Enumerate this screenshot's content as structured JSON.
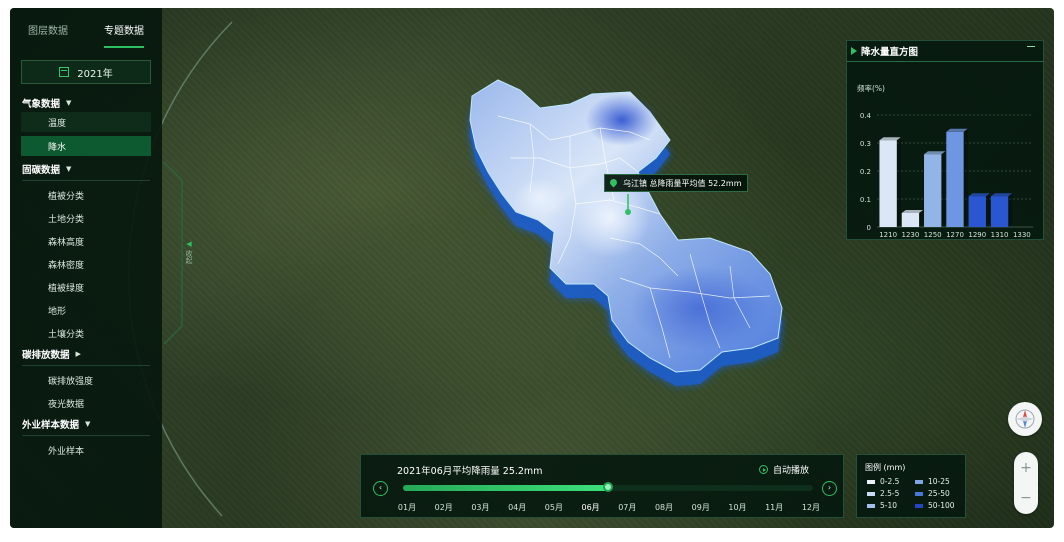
{
  "tabs": [
    "图层数据",
    "专题数据"
  ],
  "year": "2021年",
  "sidebar": {
    "weather": {
      "title": "气象数据",
      "items": [
        "温度",
        "降水"
      ]
    },
    "carbon_sink": {
      "title": "固碳数据",
      "items": [
        "植被分类",
        "土地分类",
        "森林高度",
        "森林密度",
        "植被绿度",
        "地形",
        "土壤分类"
      ]
    },
    "emission": {
      "title": "碳排放数据",
      "items": [
        "碳排放强度",
        "夜光数据"
      ]
    },
    "field": {
      "title": "外业样本数据",
      "items": [
        "外业样本"
      ]
    },
    "collapse_label": "收起"
  },
  "tooltip": "乌江镇 总降雨量平均值 52.2mm",
  "histogram": {
    "title": "降水量直方图",
    "ylabel": "频率(%)",
    "yticks": [
      "0",
      "0.1",
      "0.2",
      "0.3",
      "0.4"
    ]
  },
  "chart_data": {
    "type": "bar",
    "title": "降水量直方图",
    "ylabel": "频率(%)",
    "xlabel": "",
    "categories": [
      "1210",
      "1230",
      "1250",
      "1270",
      "1290",
      "1310",
      "1330"
    ],
    "values": [
      0.31,
      0.05,
      0.26,
      0.34,
      0.11,
      0.11,
      0.0
    ],
    "ylim": [
      0,
      0.4
    ],
    "grid": true
  },
  "timeline": {
    "title": "2021年06月平均降雨量 25.2mm",
    "play_label": "自动播放",
    "months": [
      "01月",
      "02月",
      "03月",
      "04月",
      "05月",
      "06月",
      "07月",
      "08月",
      "09月",
      "10月",
      "11月",
      "12月"
    ],
    "current_index": 5,
    "progress": 0.5
  },
  "legend": {
    "title": "图例 (mm)",
    "items": [
      {
        "label": "0-2.5",
        "color": "#e9f1fb"
      },
      {
        "label": "10-25",
        "color": "#7fa6e2"
      },
      {
        "label": "2.5-5",
        "color": "#c8daf3"
      },
      {
        "label": "25-50",
        "color": "#4a78d8"
      },
      {
        "label": "5-10",
        "color": "#a3c0ec"
      },
      {
        "label": "50-100",
        "color": "#2346c2"
      }
    ]
  },
  "colors": {
    "accent": "#2fbe63",
    "panel": "#06180e",
    "bar_light": "#dbe7f6",
    "bar_dark": "#2a56d1"
  },
  "icons": [
    "calendar-icon",
    "caret-down-icon",
    "caret-right-icon",
    "drop-icon",
    "play-icon",
    "chevron-left-icon",
    "chevron-right-icon",
    "compass-icon",
    "zoom-in-icon",
    "zoom-out-icon"
  ]
}
